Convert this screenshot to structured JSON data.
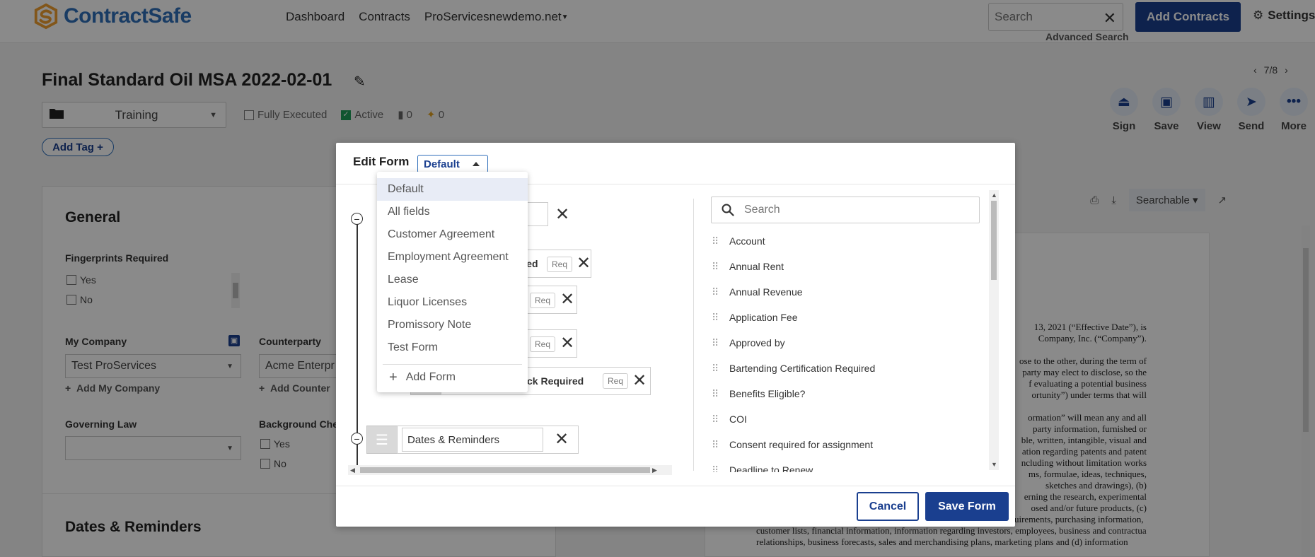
{
  "brand": {
    "name": "ContractSafe"
  },
  "nav": {
    "dashboard": "Dashboard",
    "contracts": "Contracts",
    "account": "ProServicesnewdemo.net"
  },
  "header": {
    "search_placeholder": "Search",
    "advanced_search": "Advanced Search",
    "add_contracts": "Add Contracts",
    "settings": "Settings"
  },
  "contract": {
    "title": "Final Standard Oil MSA 2022-02-01",
    "pager": "7/8",
    "folder": "Training",
    "fully_executed": "Fully Executed",
    "active": "Active",
    "attachments_count": "0",
    "pins_count": "0",
    "add_tag": "Add Tag"
  },
  "actions": [
    {
      "label": "Sign",
      "icon": "sign-icon"
    },
    {
      "label": "Save",
      "icon": "save-icon"
    },
    {
      "label": "View",
      "icon": "view-icon"
    },
    {
      "label": "Send",
      "icon": "send-icon"
    },
    {
      "label": "More",
      "icon": "more-icon"
    }
  ],
  "general": {
    "title": "General",
    "fingerprints_label": "Fingerprints Required",
    "yes": "Yes",
    "no": "No",
    "my_company_label": "My Company",
    "my_company_value": "Test ProServices",
    "add_my_company": "Add My Company",
    "counterparty_label": "Counterparty",
    "counterparty_value": "Acme Enterpr",
    "add_counterparty": "Add Counter",
    "governing_law_label": "Governing Law",
    "background_check_label": "Background Che",
    "dates_title": "Dates & Reminders"
  },
  "doc": {
    "searchable": "Searchable",
    "text_lines": [
      "13, 2021 (“Effective Date”), is",
      "Company, Inc. (“Company”).",
      "",
      "ose to the other, during the term of",
      "party may elect to disclose, so the",
      "f evaluating a potential business",
      "ortunity”) under terms that will",
      "",
      "ormation” will mean any and all",
      "party information, furnished or",
      "ble, written, intangible, visual and",
      "ation regarding patents and patent",
      "ncluding without limitation works",
      "ms, formulae, ideas, techniques,",
      "sketches and drawings), (b)",
      "erning the research, experimental",
      "osed and/or future products, (c)",
      "engineering information, manufacturing information, procurement requirements, purchasing information,",
      "customer lists, financial information, information regarding investors, employees, business and contractual",
      "relationships, business forecasts, sales and merchandising plans, marketing plans and (d) information"
    ]
  },
  "modal": {
    "title": "Edit Form",
    "selected_form": "Default",
    "search_placeholder": "Search",
    "cancel": "Cancel",
    "save": "Save Form",
    "tree_items": [
      {
        "label": "",
        "req": ""
      },
      {
        "label": "equired",
        "req": "Req"
      },
      {
        "label": "",
        "req": "Req"
      },
      {
        "label": "",
        "req": "Req"
      },
      {
        "label": "Background Check Required",
        "req": "Req"
      },
      {
        "label": "Dates & Reminders",
        "req": ""
      }
    ],
    "available_fields": [
      "Account",
      "Annual Rent",
      "Annual Revenue",
      "Application Fee",
      "Approved by",
      "Bartending Certification Required",
      "Benefits Eligible?",
      "COI",
      "Consent required for assignment",
      "Deadline to Renew"
    ]
  },
  "dropdown": {
    "options": [
      "Default",
      "All fields",
      "Customer Agreement",
      "Employment Agreement",
      "Lease",
      "Liquor Licenses",
      "Promissory Note",
      "Test Form"
    ],
    "selected_index": 0,
    "add_form": "Add Form"
  },
  "colors": {
    "brand": "#2f6fba",
    "primary": "#1a3f8f",
    "active_check": "#1e9e5a",
    "logo_orange": "#f0a030"
  }
}
